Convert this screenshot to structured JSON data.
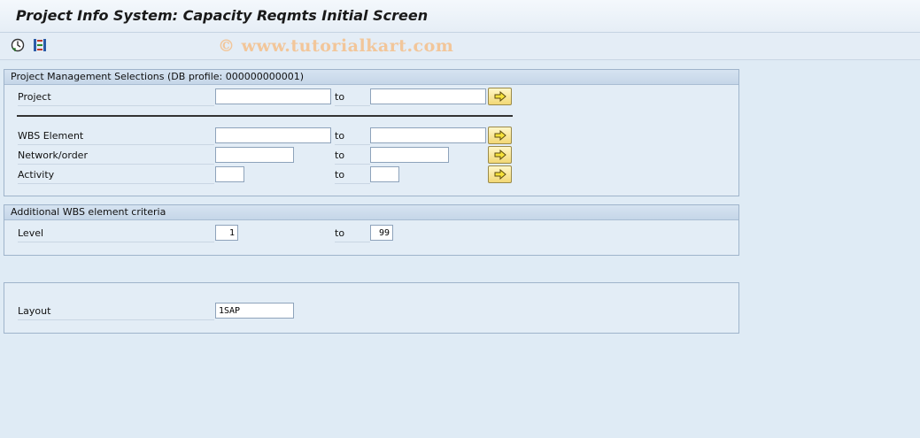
{
  "window": {
    "title": "Project Info System: Capacity Reqmts Initial Screen"
  },
  "toolbar": {
    "watermark": "© www.tutorialkart.com",
    "icons": [
      "execute-icon",
      "selection-options-icon"
    ]
  },
  "groups": {
    "project_mgmt": {
      "header": "Project Management Selections (DB profile: 000000000001)",
      "rows": [
        {
          "label": "Project",
          "from": "",
          "to_label": "to",
          "to": ""
        },
        {
          "label": "WBS Element",
          "from": "",
          "to_label": "to",
          "to": ""
        },
        {
          "label": "Network/order",
          "from": "",
          "to_label": "to",
          "to": ""
        },
        {
          "label": "Activity",
          "from": "",
          "to_label": "to",
          "to": ""
        }
      ]
    },
    "wbs_criteria": {
      "header": "Additional WBS element criteria",
      "level": {
        "label": "Level",
        "from": "1",
        "to_label": "to",
        "to": "99"
      }
    },
    "layout": {
      "label": "Layout",
      "value": "1SAP"
    }
  },
  "colors": {
    "background": "#dfebf5",
    "group_header": "#c5d6e8",
    "button_accent": "#f2d875",
    "watermark": "#f2c69a"
  }
}
